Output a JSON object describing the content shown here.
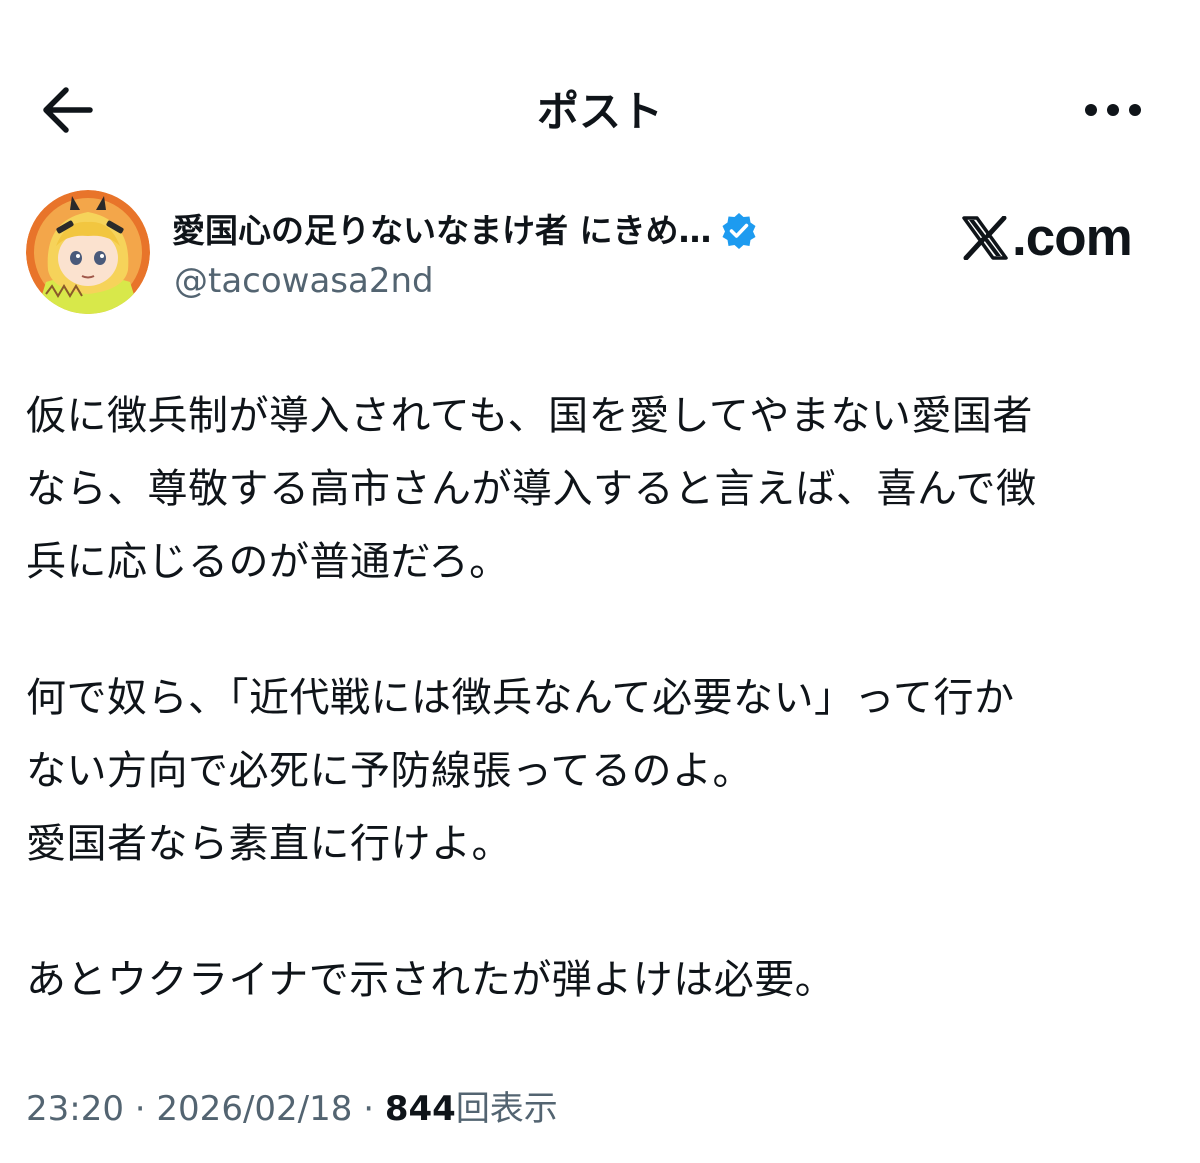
{
  "header": {
    "title": "ポスト",
    "back_icon": "arrow-left-icon",
    "more_icon": "more-horizontal-icon"
  },
  "author": {
    "display_name": "愛国心の足りないなまけ者 にきめ…",
    "handle": "@tacowasa2nd",
    "verified": true,
    "verified_color": "#1d9bf0"
  },
  "watermark": {
    "logo_icon": "x-logo-icon",
    "text": ".com"
  },
  "tweet": {
    "paragraphs": [
      [
        "仮に徴兵制が導入されても、国を愛してやまない愛国者",
        "なら、尊敬する高市さんが導入すると言えば、喜んで徴",
        "兵に応じるのが普通だろ。"
      ],
      [
        "何で奴ら、「近代戦には徴兵なんて必要ない」って行か",
        "ない方向で必死に予防線張ってるのよ。",
        "愛国者なら素直に行けよ。"
      ],
      [
        "あとウクライナで示されたが弾よけは必要。"
      ]
    ]
  },
  "meta": {
    "time": "23:20",
    "separator": "·",
    "date": "2026/02/18",
    "view_count": "844",
    "view_label": "回表示"
  },
  "colors": {
    "text_primary": "#0f1419",
    "text_secondary": "#536471",
    "background": "#ffffff"
  }
}
